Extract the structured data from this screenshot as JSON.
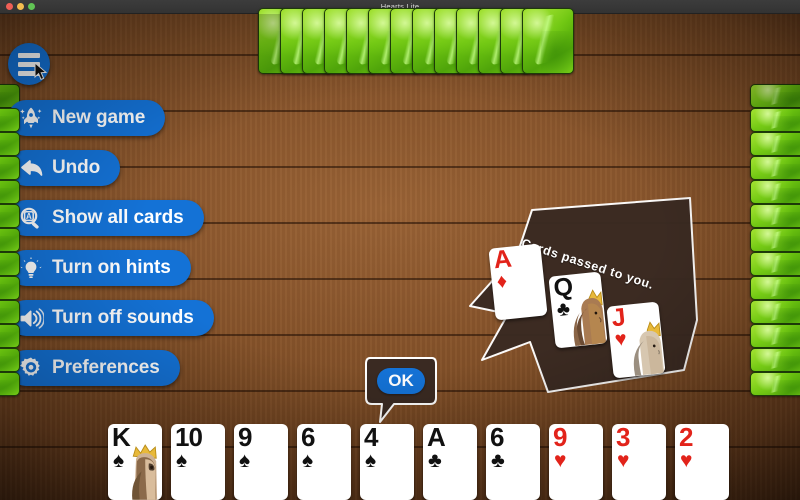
{
  "window": {
    "title": "Hearts Lite",
    "traffic_lights": [
      {
        "name": "close",
        "color": "#ef5f56"
      },
      {
        "name": "minimize",
        "color": "#f5bd4f"
      },
      {
        "name": "zoom",
        "color": "#61c454"
      }
    ]
  },
  "theme": {
    "button_blue": "#1472d6",
    "table_wood": "#7e4d26",
    "card_back_green": "#6cc410",
    "red_suit": "#e2231a",
    "black_suit": "#111111",
    "bubble_dark": "#3a2a22"
  },
  "menu": {
    "toggle_label": "menu",
    "items": [
      {
        "label": "New game",
        "icon": "rocket-icon"
      },
      {
        "label": "Undo",
        "icon": "undo-arrow-icon"
      },
      {
        "label": "Show all cards",
        "icon": "magnifier-icon"
      },
      {
        "label": "Turn on hints",
        "icon": "lightbulb-icon"
      },
      {
        "label": "Turn off sounds",
        "icon": "speaker-icon"
      },
      {
        "label": "Preferences",
        "icon": "gear-icon"
      }
    ]
  },
  "message": {
    "text": "Cards passed to you.",
    "ok_label": "OK",
    "passed_cards": [
      {
        "rank": "A",
        "suit": "♦",
        "color": "red",
        "face": false
      },
      {
        "rank": "Q",
        "suit": "♣",
        "color": "black",
        "face": true
      },
      {
        "rank": "J",
        "suit": "♥",
        "color": "red",
        "face": true
      }
    ]
  },
  "player_hand": {
    "count": 10,
    "cards": [
      {
        "rank": "K",
        "suit": "♠",
        "color": "black",
        "face": true
      },
      {
        "rank": "10",
        "suit": "♠",
        "color": "black",
        "face": false
      },
      {
        "rank": "9",
        "suit": "♠",
        "color": "black",
        "face": false
      },
      {
        "rank": "6",
        "suit": "♠",
        "color": "black",
        "face": false
      },
      {
        "rank": "4",
        "suit": "♠",
        "color": "black",
        "face": false
      },
      {
        "rank": "A",
        "suit": "♣",
        "color": "black",
        "face": false
      },
      {
        "rank": "6",
        "suit": "♣",
        "color": "black",
        "face": false
      },
      {
        "rank": "9",
        "suit": "♥",
        "color": "red",
        "face": false
      },
      {
        "rank": "3",
        "suit": "♥",
        "color": "red",
        "face": false
      },
      {
        "rank": "2",
        "suit": "♥",
        "color": "red",
        "face": false
      }
    ]
  },
  "opponents": {
    "top": {
      "card_count": 13,
      "orientation": "vertical"
    },
    "left": {
      "card_count": 13,
      "orientation": "horizontal"
    },
    "right": {
      "card_count": 13,
      "orientation": "horizontal"
    }
  }
}
